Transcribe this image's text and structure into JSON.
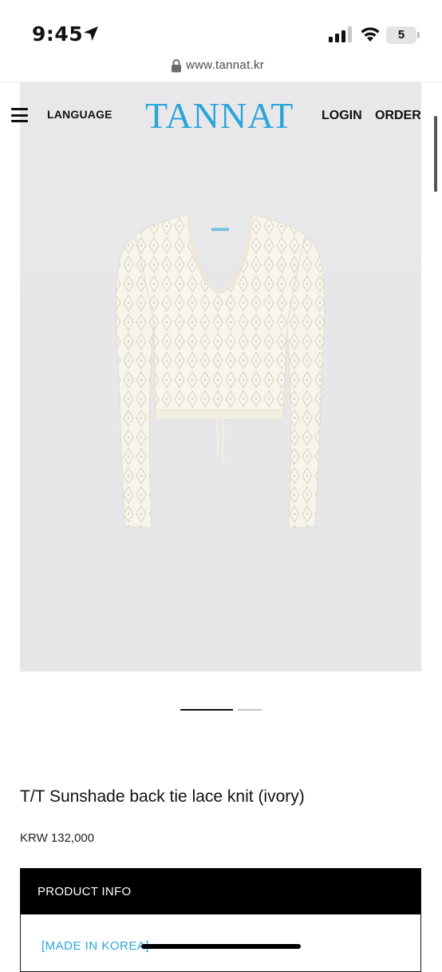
{
  "status_bar": {
    "time": "9:45",
    "battery": "5"
  },
  "browser": {
    "url": "www.tannat.kr"
  },
  "header": {
    "language_label": "LANGUAGE",
    "logo": "TANNAT",
    "login_label": "LOGIN",
    "order_label": "ORDER"
  },
  "gallery": {
    "current_slide": 1,
    "total_slides": 2
  },
  "product": {
    "title": "T/T Sunshade back tie lace knit (ivory)",
    "price": "KRW 132,000",
    "info_header": "PRODUCT INFO",
    "made_in": "[MADE IN KOREA]"
  },
  "colors": {
    "brand": "#2aa5d8",
    "hero_bg": "#e9e9eb",
    "garment": "#f7f4ea"
  },
  "icons": [
    "location-arrow-icon",
    "signal-icon",
    "wifi-icon",
    "battery-icon",
    "lock-icon",
    "menu-icon"
  ]
}
